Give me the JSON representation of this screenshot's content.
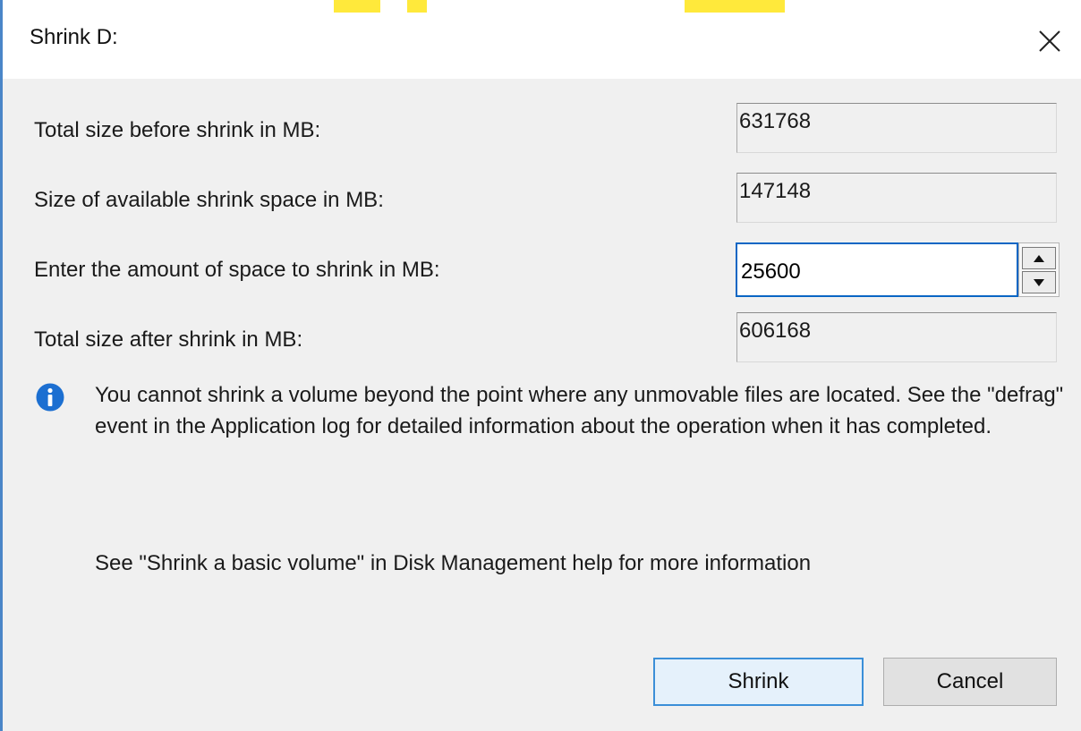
{
  "dialog": {
    "title": "Shrink D:",
    "close_icon": "close-icon"
  },
  "fields": {
    "total_before": {
      "label": "Total size before shrink in MB:",
      "value": "631768"
    },
    "available": {
      "label": "Size of available shrink space in MB:",
      "value": "147148"
    },
    "amount": {
      "label": "Enter the amount of space to shrink in MB:",
      "value": "25600"
    },
    "total_after": {
      "label": "Total size after shrink in MB:",
      "value": "606168"
    }
  },
  "info": {
    "icon": "info-icon",
    "text": "You cannot shrink a volume beyond the point where any unmovable files are located. See the \"defrag\" event in the Application log for detailed information about the operation when it has completed."
  },
  "help_text": "See \"Shrink a basic volume\" in Disk Management help for more information",
  "buttons": {
    "shrink": "Shrink",
    "cancel": "Cancel"
  },
  "colors": {
    "accent": "#0a66c4",
    "info_icon": "#1c6fd1",
    "dialog_bg": "#f0f0f0"
  }
}
